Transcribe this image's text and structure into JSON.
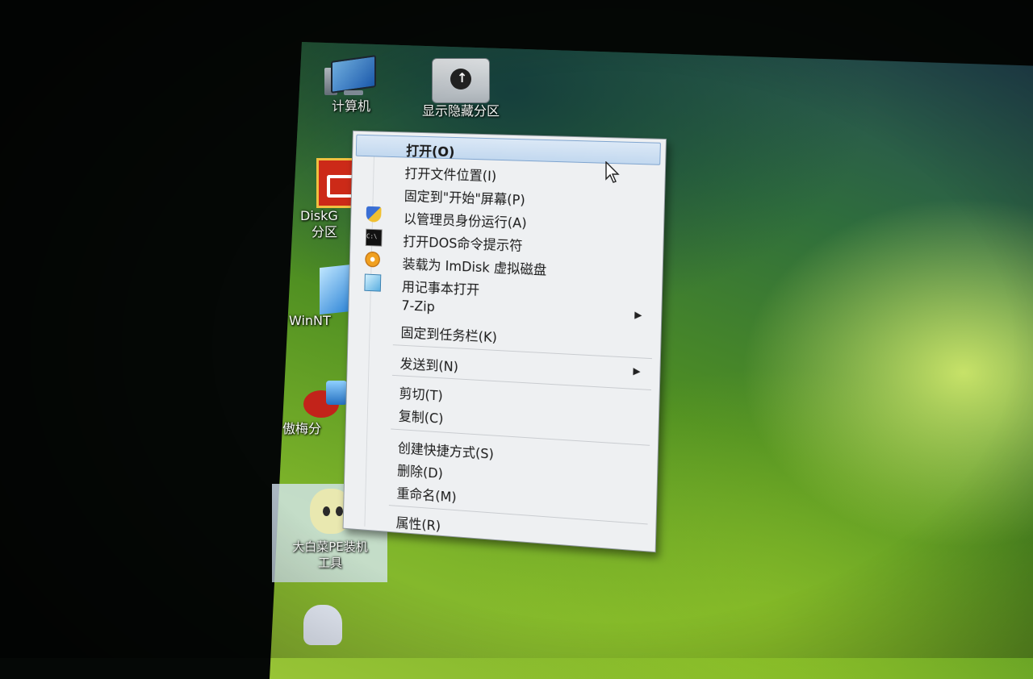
{
  "desktop": {
    "icons": [
      {
        "label": "计算机"
      },
      {
        "label": "显示隐藏分区"
      },
      {
        "label": "DiskG"
      },
      {
        "label": "分区"
      },
      {
        "label": "WinNT"
      },
      {
        "label": "傲梅分"
      },
      {
        "label": "大白菜PE装机"
      },
      {
        "label": "工具"
      }
    ]
  },
  "context_menu": {
    "items": [
      {
        "label": "打开(O)"
      },
      {
        "label": "打开文件位置(I)"
      },
      {
        "label": "固定到\"开始\"屏幕(P)"
      },
      {
        "label": "以管理员身份运行(A)"
      },
      {
        "label": "打开DOS命令提示符"
      },
      {
        "label": "装载为 ImDisk 虚拟磁盘"
      },
      {
        "label": "用记事本打开"
      },
      {
        "label": "7-Zip"
      },
      {
        "label": "固定到任务栏(K)"
      },
      {
        "label": "发送到(N)"
      },
      {
        "label": "剪切(T)"
      },
      {
        "label": "复制(C)"
      },
      {
        "label": "创建快捷方式(S)"
      },
      {
        "label": "删除(D)"
      },
      {
        "label": "重命名(M)"
      },
      {
        "label": "属性(R)"
      }
    ],
    "cmd_glyph": "C:\\",
    "submenu_arrow": "▶"
  },
  "colors": {
    "menu_bg": "#eef0f2",
    "highlight": "#c2d8ef",
    "desktop_green": "#7fb52a"
  }
}
